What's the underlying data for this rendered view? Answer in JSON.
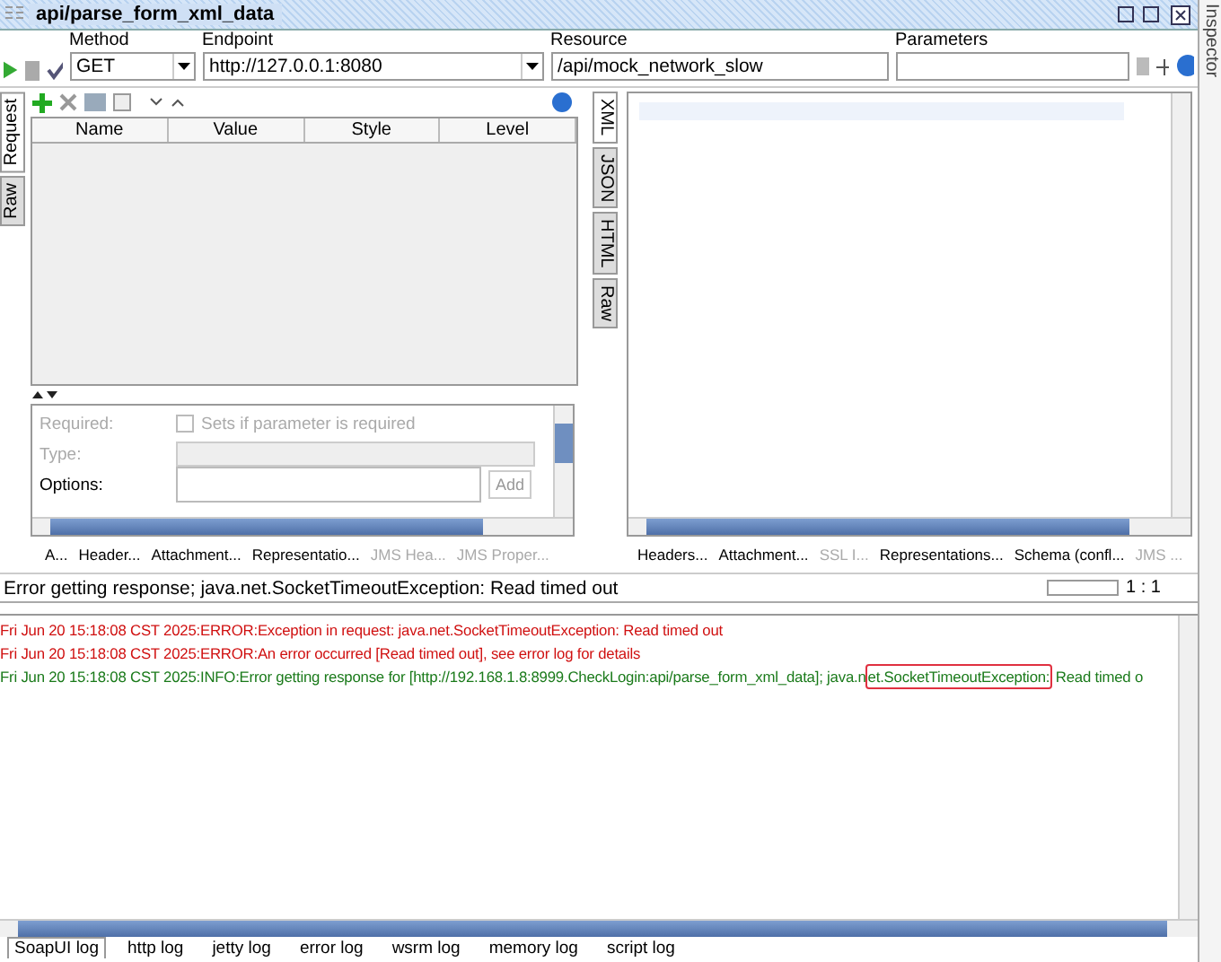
{
  "window": {
    "title": "api/parse_form_xml_data"
  },
  "toolbar": {
    "method_label": "Method",
    "method": "GET",
    "endpoint_label": "Endpoint",
    "endpoint": "http://127.0.0.1:8080",
    "resource_label": "Resource",
    "resource": "/api/mock_network_slow",
    "parameters_label": "Parameters"
  },
  "request": {
    "side_tabs": [
      {
        "label": "Request",
        "selected": true
      },
      {
        "label": "Raw",
        "selected": false
      }
    ],
    "columns": [
      "Name",
      "Value",
      "Style",
      "Level"
    ],
    "properties": [
      {
        "kind": "checkbox",
        "label": "Required:",
        "disabled": true,
        "checked": false,
        "text": "Sets if parameter is required"
      },
      {
        "kind": "select",
        "label": "Type:",
        "disabled": true
      },
      {
        "kind": "list",
        "label": "Options:",
        "disabled": false,
        "button": "Add"
      }
    ],
    "bottom_tabs": [
      {
        "label": "A...",
        "disabled": false
      },
      {
        "label": "Header...",
        "disabled": false
      },
      {
        "label": "Attachment...",
        "disabled": false
      },
      {
        "label": "Representatio...",
        "disabled": false
      },
      {
        "label": "JMS Hea...",
        "disabled": true
      },
      {
        "label": "JMS Proper...",
        "disabled": true
      }
    ]
  },
  "response": {
    "side_tabs": [
      {
        "label": "XML",
        "selected": true
      },
      {
        "label": "JSON",
        "selected": false
      },
      {
        "label": "HTML",
        "selected": false
      },
      {
        "label": "Raw",
        "selected": false
      }
    ],
    "bottom_tabs": [
      {
        "label": "Headers...",
        "disabled": false
      },
      {
        "label": "Attachment...",
        "disabled": false
      },
      {
        "label": "SSL I...",
        "disabled": true
      },
      {
        "label": "Representations...",
        "disabled": false
      },
      {
        "label": "Schema (confl...",
        "disabled": false
      },
      {
        "label": "JMS ...",
        "disabled": true
      }
    ]
  },
  "status": {
    "message": "Error getting response; java.net.SocketTimeoutException: Read timed out",
    "position": "1 : 1"
  },
  "log": {
    "lines": [
      {
        "kind": "error",
        "text": "Fri Jun 20 15:18:08 CST 2025:ERROR:Exception in request: java.net.SocketTimeoutException: Read timed out"
      },
      {
        "kind": "error",
        "text": "Fri Jun 20 15:18:08 CST 2025:ERROR:An error occurred [Read timed out], see error log for details"
      },
      {
        "kind": "info",
        "text": "Fri Jun 20 15:18:08 CST 2025:INFO:Error getting response for [http://192.168.1.8:8999.CheckLogin:api/parse_form_xml_data]; java.n",
        "highlight": "et.SocketTimeoutException:",
        "after": " Read timed o"
      }
    ]
  },
  "log_tabs": [
    {
      "label": "SoapUI log",
      "selected": true
    },
    {
      "label": "http log",
      "selected": false
    },
    {
      "label": "jetty log",
      "selected": false
    },
    {
      "label": "error log",
      "selected": false
    },
    {
      "label": "wsrm log",
      "selected": false
    },
    {
      "label": "memory log",
      "selected": false
    },
    {
      "label": "script log",
      "selected": false
    }
  ],
  "inspector": {
    "label": "Inspector"
  }
}
